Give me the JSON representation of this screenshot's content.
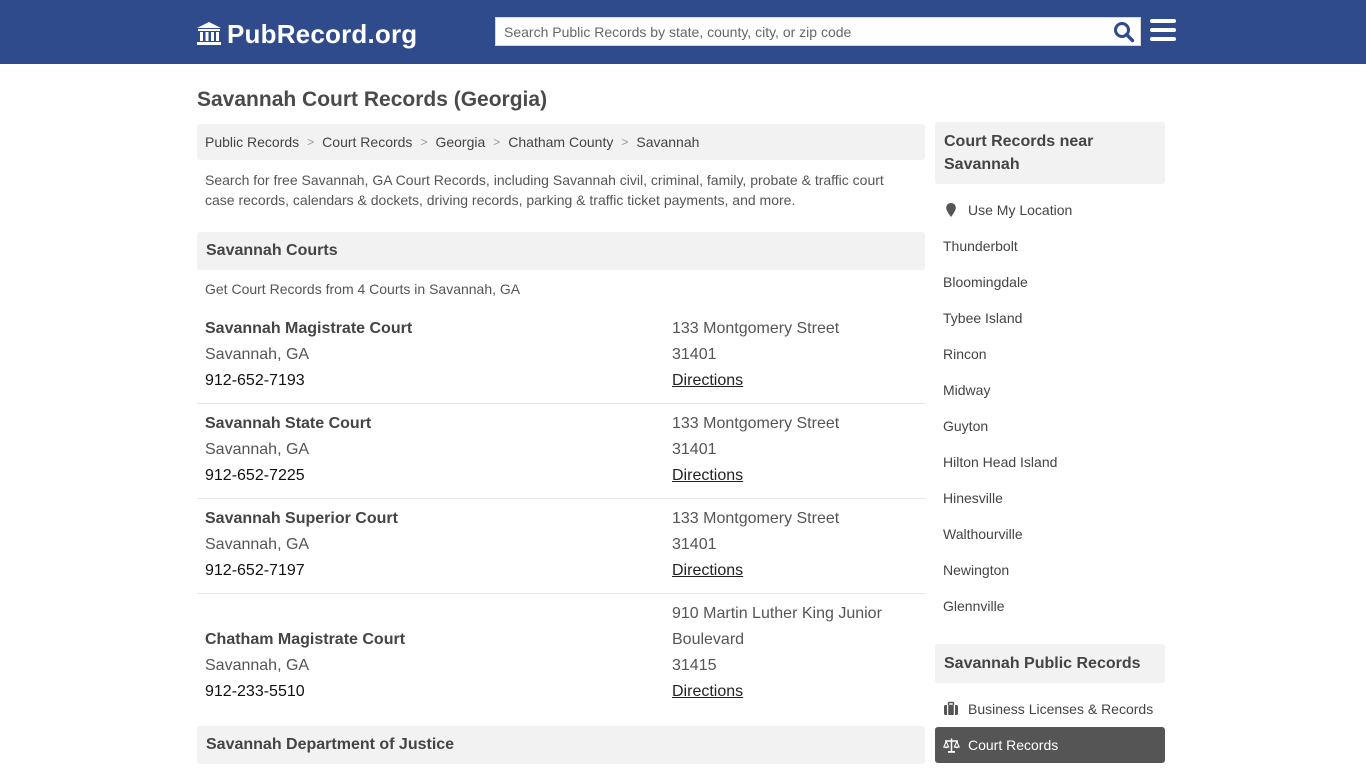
{
  "header": {
    "logo_text": "PubRecord.org",
    "search_placeholder": "Search Public Records by state, county, city, or zip code",
    "colors": {
      "bar": "#2f4b8c",
      "search_icon": "#2f4b8c"
    }
  },
  "page": {
    "title": "Savannah Court Records (Georgia)",
    "breadcrumb": [
      "Public Records",
      "Court Records",
      "Georgia",
      "Chatham County",
      "Savannah"
    ],
    "intro": "Search for free Savannah, GA Court Records, including Savannah civil, criminal, family, probate & traffic court case records, calendars & dockets, driving records, parking & traffic ticket payments, and more."
  },
  "courts_section": {
    "heading": "Savannah Courts",
    "subtext": "Get Court Records from 4 Courts in Savannah, GA",
    "courts": [
      {
        "name": "Savannah Magistrate Court",
        "city": "Savannah, GA",
        "phone": "912-652-7193",
        "address_lines": [
          "133 Montgomery Street",
          "31401"
        ],
        "directions": "Directions"
      },
      {
        "name": "Savannah State Court",
        "city": "Savannah, GA",
        "phone": "912-652-7225",
        "address_lines": [
          "133 Montgomery Street",
          "31401"
        ],
        "directions": "Directions"
      },
      {
        "name": "Savannah Superior Court",
        "city": "Savannah, GA",
        "phone": "912-652-7197",
        "address_lines": [
          "133 Montgomery Street",
          "31401"
        ],
        "directions": "Directions"
      },
      {
        "name": "Chatham Magistrate Court",
        "city": "Savannah, GA",
        "phone": "912-233-5510",
        "address_lines": [
          "910 Martin Luther King Junior",
          "Boulevard",
          "31415"
        ],
        "directions": "Directions"
      }
    ]
  },
  "doj_section": {
    "heading": "Savannah Department of Justice"
  },
  "sidebar": {
    "nearby_heading": "Court Records near Savannah",
    "use_location": "Use My Location",
    "nearby": [
      "Thunderbolt",
      "Bloomingdale",
      "Tybee Island",
      "Rincon",
      "Midway",
      "Guyton",
      "Hilton Head Island",
      "Hinesville",
      "Walthourville",
      "Newington",
      "Glennville"
    ],
    "public_heading": "Savannah Public Records",
    "public_links": [
      {
        "label": "Business Licenses & Records",
        "icon": "briefcase-icon"
      },
      {
        "label": "Court Records",
        "icon": "scales-icon"
      }
    ]
  }
}
